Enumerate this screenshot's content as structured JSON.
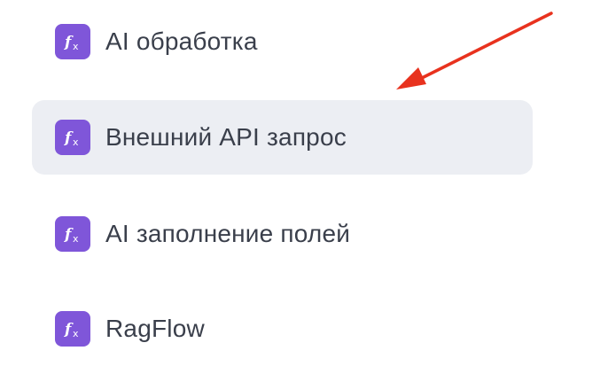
{
  "menu": {
    "items": [
      {
        "label": "AI обработка",
        "icon": "function-icon",
        "highlighted": false
      },
      {
        "label": "Внешний API запрос",
        "icon": "function-icon",
        "highlighted": true
      },
      {
        "label": "AI заполнение полей",
        "icon": "function-icon",
        "highlighted": false
      },
      {
        "label": "RagFlow",
        "icon": "function-icon",
        "highlighted": false
      }
    ]
  },
  "colors": {
    "icon_background": "#7f56d9",
    "highlight_background": "#eceef3",
    "text": "#3a3f4b",
    "annotation_arrow": "#e8321e"
  }
}
